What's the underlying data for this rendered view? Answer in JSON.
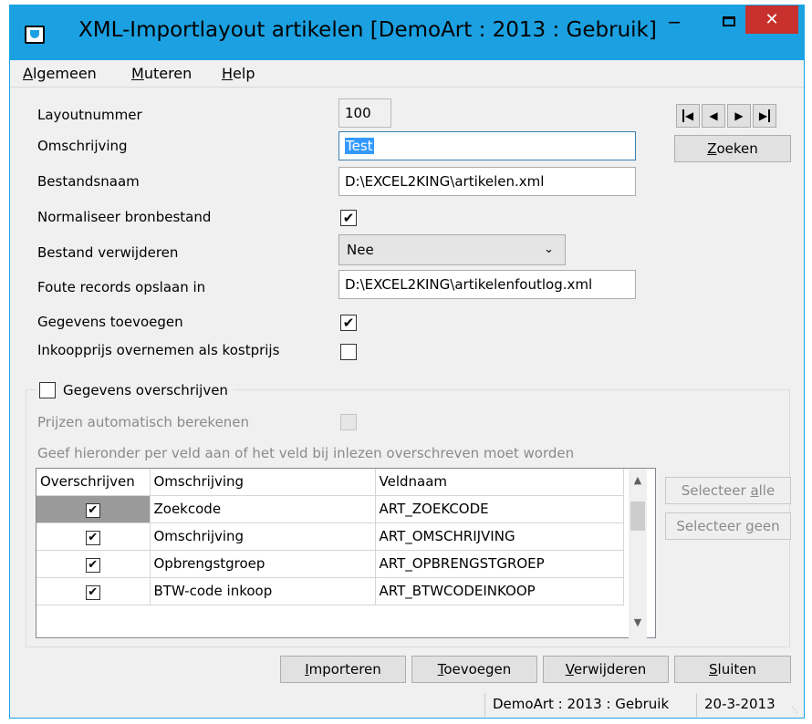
{
  "window": {
    "title": "XML-Importlayout artikelen  [DemoArt : 2013 : Gebruik]",
    "minimize_glyph": "‒",
    "close_glyph": "✕"
  },
  "menu": {
    "items": [
      {
        "hot": "A",
        "rest": "lgemeen"
      },
      {
        "hot": "M",
        "rest": "uteren"
      },
      {
        "hot": "H",
        "rest": "elp"
      }
    ]
  },
  "form": {
    "layoutnummer_label": "Layoutnummer",
    "layoutnummer_value": "100",
    "omschrijving_label": "Omschrijving",
    "omschrijving_value": "Test",
    "bestandsnaam_label": "Bestandsnaam",
    "bestandsnaam_value": "D:\\EXCEL2KING\\artikelen.xml",
    "normaliseer_label": "Normaliseer bronbestand",
    "normaliseer_checked": true,
    "verwijderen_label": "Bestand verwijderen",
    "verwijderen_value": "Nee",
    "foute_records_label": "Foute records opslaan in",
    "foute_records_value": "D:\\EXCEL2KING\\artikelenfoutlog.xml",
    "toevoegen_label": "Gegevens toevoegen",
    "toevoegen_checked": true,
    "inkoopprijs_label": "Inkoopprijs overnemen als kostprijs",
    "inkoopprijs_checked": false
  },
  "nav": {
    "first": "◀",
    "prev": "◀",
    "next": "▶",
    "last": "▶",
    "zoeken_hot": "Z",
    "zoeken_rest": "oeken"
  },
  "overschrijven": {
    "group_label": "Gegevens overschrijven",
    "group_checked": false,
    "prijzen_label": "Prijzen automatisch berekenen",
    "hint": "Geef hieronder per veld aan of het veld bij inlezen overschreven moet worden",
    "columns": [
      "Overschrijven",
      "Omschrijving",
      "Veldnaam"
    ],
    "rows": [
      {
        "checked": true,
        "omschrijving": "Zoekcode",
        "veldnaam": "ART_ZOEKCODE"
      },
      {
        "checked": true,
        "omschrijving": "Omschrijving",
        "veldnaam": "ART_OMSCHRIJVING"
      },
      {
        "checked": true,
        "omschrijving": "Opbrengstgroep",
        "veldnaam": "ART_OPBRENGSTGROEP"
      },
      {
        "checked": true,
        "omschrijving": "BTW-code inkoop",
        "veldnaam": "ART_BTWCODEINKOOP"
      }
    ],
    "select_all_pre": "Selecteer ",
    "select_all_hot": "a",
    "select_all_post": "lle",
    "select_none_pre": "Selecteer ",
    "select_none_hot": "g",
    "select_none_post": "een"
  },
  "buttons": {
    "importeren_hot": "I",
    "importeren_rest": "mporteren",
    "toevoegen_hot": "T",
    "toevoegen_rest": "oevoegen",
    "verwijderen_hot": "V",
    "verwijderen_rest": "erwijderen",
    "sluiten_hot": "S",
    "sluiten_rest": "luiten"
  },
  "status": {
    "context": "DemoArt : 2013 : Gebruik",
    "date": "20-3-2013"
  }
}
